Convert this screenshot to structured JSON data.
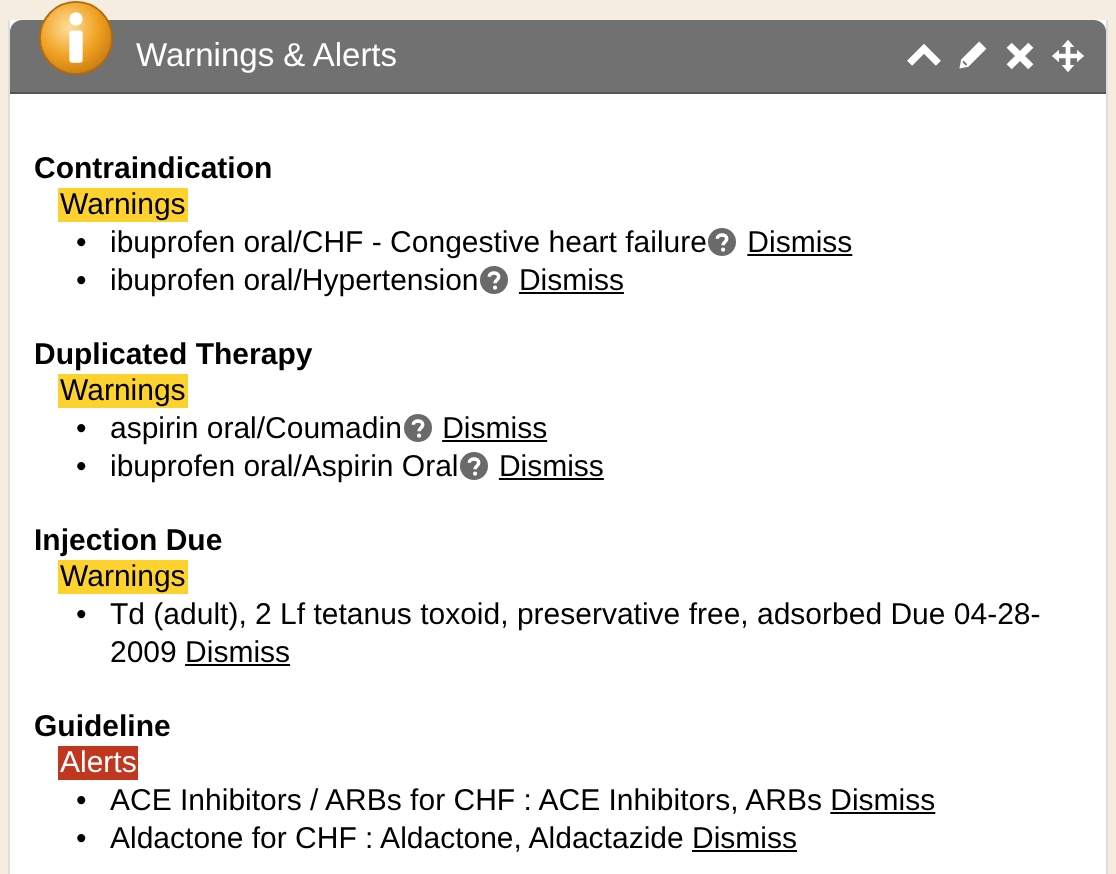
{
  "panel": {
    "title": "Warnings & Alerts"
  },
  "sections": [
    {
      "heading": "Contraindication",
      "tag": {
        "kind": "warnings",
        "label": "Warnings"
      },
      "items": [
        {
          "bullet": "•",
          "text": "ibuprofen oral/CHF - Congestive heart failure",
          "help": true,
          "link": "Dismiss"
        },
        {
          "bullet": "•",
          "text": "ibuprofen oral/Hypertension",
          "help": true,
          "link": "Dismiss"
        }
      ]
    },
    {
      "heading": "Duplicated Therapy",
      "tag": {
        "kind": "warnings",
        "label": "Warnings"
      },
      "items": [
        {
          "bullet": "•",
          "text": "aspirin oral/Coumadin",
          "help": true,
          "link": "Dismiss"
        },
        {
          "bullet": "•",
          "text": "ibuprofen oral/Aspirin Oral",
          "help": true,
          "link": "Dismiss"
        }
      ]
    },
    {
      "heading": "Injection Due",
      "tag": {
        "kind": "warnings",
        "label": "Warnings"
      },
      "items": [
        {
          "bullet": "•",
          "text": "Td (adult), 2 Lf tetanus toxoid, preservative free, adsorbed Due 04-28-2009",
          "help": false,
          "link": "Dismiss"
        }
      ]
    },
    {
      "heading": "Guideline",
      "tag": {
        "kind": "alerts",
        "label": "Alerts"
      },
      "items": [
        {
          "bullet": "•",
          "text": "ACE Inhibitors / ARBs for CHF : ACE Inhibitors, ARBs",
          "help": false,
          "link": "Dismiss"
        },
        {
          "bullet": "•",
          "text": "Aldactone for CHF : Aldactone, Aldactazide",
          "help": false,
          "link": "Dismiss"
        }
      ]
    }
  ]
}
